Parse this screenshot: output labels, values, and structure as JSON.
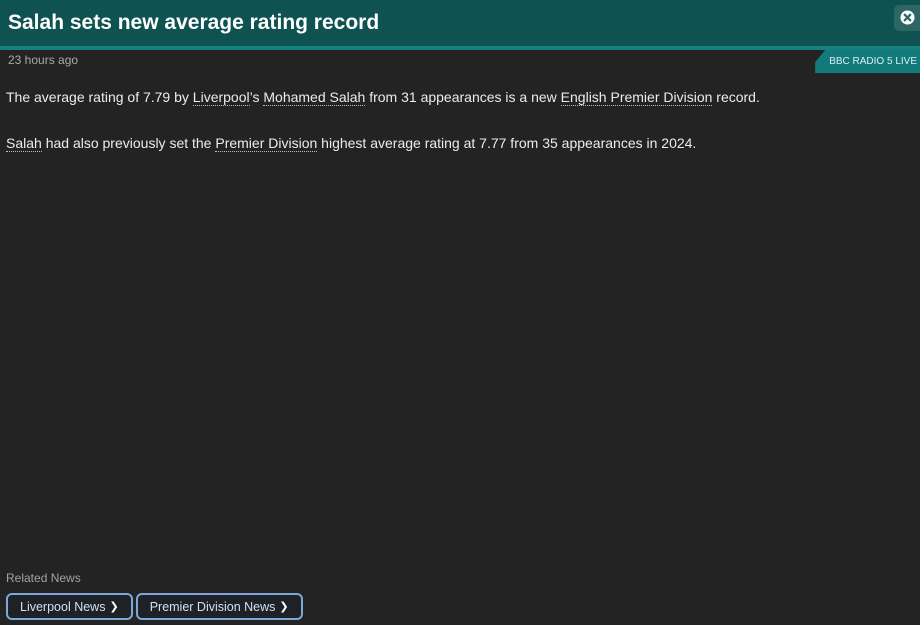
{
  "header": {
    "title": "Salah sets new average rating record",
    "close_icon": "close-circle-icon"
  },
  "meta": {
    "timestamp": "23 hours ago",
    "source": "BBC RADIO 5 LIVE"
  },
  "article": {
    "p1": {
      "t1": "The average rating of 7.79 by ",
      "link_club": "Liverpool",
      "t2": "’s ",
      "link_player": "Mohamed Salah",
      "t3": " from 31 appearances is a new ",
      "link_league": "English Premier Division",
      "t4": " record."
    },
    "p2": {
      "link_player": "Salah",
      "t1": " had also previously set the ",
      "link_league": "Premier Division",
      "t2": " highest average rating at 7.77 from 35 appearances in 2024."
    }
  },
  "related": {
    "heading": "Related News",
    "buttons": [
      {
        "label": "Liverpool News",
        "icon": "chevron-right-icon"
      },
      {
        "label": "Premier Division News",
        "icon": "chevron-right-icon"
      }
    ]
  },
  "colors": {
    "header_bg": "#0e5252",
    "accent": "#168080",
    "background": "#232323",
    "button_border": "#7ea8d8"
  }
}
